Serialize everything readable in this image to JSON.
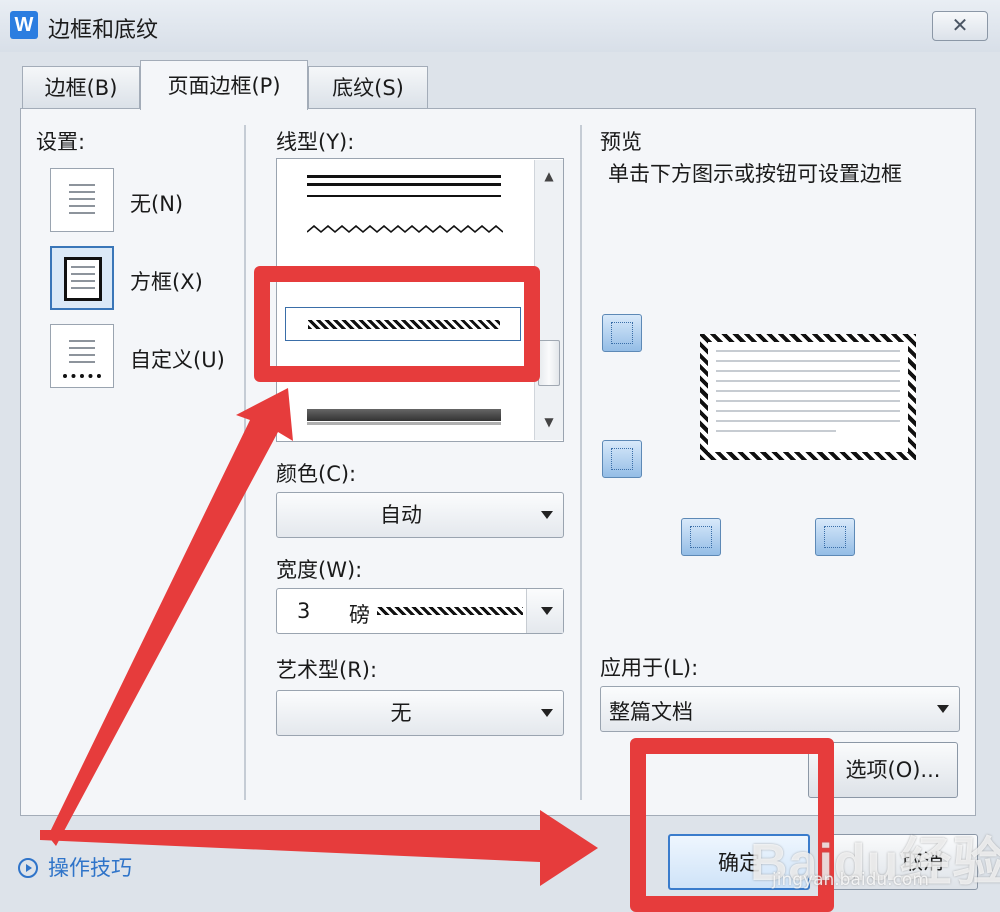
{
  "window": {
    "title": "边框和底纹",
    "app_icon": "W",
    "close_glyph": "✕"
  },
  "tabs": [
    {
      "label": "边框(B)",
      "active": false
    },
    {
      "label": "页面边框(P)",
      "active": true
    },
    {
      "label": "底纹(S)",
      "active": false
    }
  ],
  "settings": {
    "label": "设置:",
    "options": [
      {
        "label": "无(N)",
        "icon": "page-none-icon",
        "selected": false
      },
      {
        "label": "方框(X)",
        "icon": "page-box-icon",
        "selected": true
      },
      {
        "label": "自定义(U)",
        "icon": "page-custom-icon",
        "selected": false
      }
    ]
  },
  "line_style": {
    "label": "线型(Y):",
    "items": [
      "double-thick-thin",
      "wavy",
      "dashed-hatched",
      "thick-shadow"
    ],
    "selected": "dashed-hatched"
  },
  "color": {
    "label": "颜色(C):",
    "value": "自动"
  },
  "width": {
    "label": "宽度(W):",
    "value": "3",
    "unit": "磅"
  },
  "art": {
    "label": "艺术型(R):",
    "value": "无"
  },
  "preview": {
    "label": "预览",
    "hint": "单击下方图示或按钮可设置边框"
  },
  "apply_to": {
    "label": "应用于(L):",
    "value": "整篇文档"
  },
  "buttons": {
    "options": "选项(O)...",
    "ok": "确定",
    "cancel": "取消"
  },
  "tips": {
    "label": "操作技巧"
  },
  "watermark": {
    "logo": "Baidu经验",
    "url": "jingyan.baidu.com"
  },
  "annotation_color": "#e63c3c",
  "accent_color": "#2f74c9"
}
